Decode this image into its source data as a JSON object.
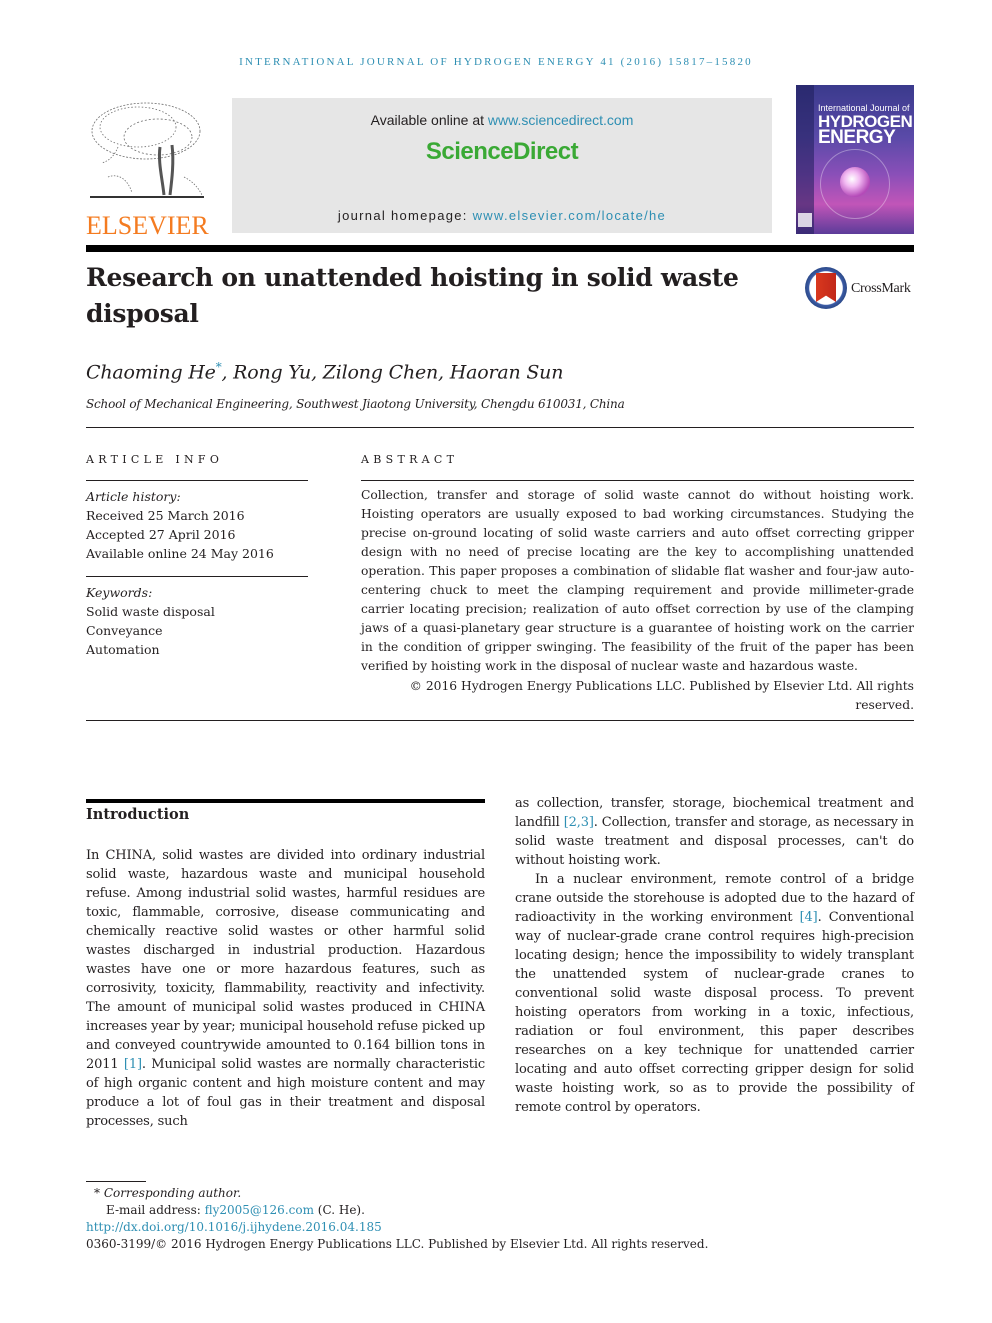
{
  "running_head": "INTERNATIONAL JOURNAL OF HYDROGEN ENERGY 41 (2016) 15817–15820",
  "masthead": {
    "publisher_logo_text": "ELSEVIER",
    "available_online_prefix": "Available online at ",
    "available_online_link": "www.sciencedirect.com",
    "platform_name": "ScienceDirect",
    "homepage_prefix": "journal homepage: ",
    "homepage_link": "www.elsevier.com/locate/he",
    "cover": {
      "line1": "International Journal of",
      "line2": "HYDROGEN",
      "line3": "ENERGY"
    }
  },
  "article": {
    "title": "Research on unattended hoisting in solid waste disposal",
    "crossmark_label": "CrossMark",
    "authors": [
      {
        "name": "Chaoming He",
        "corresponding": true,
        "mark": "*"
      },
      {
        "name": "Rong Yu"
      },
      {
        "name": "Zilong Chen"
      },
      {
        "name": "Haoran Sun"
      }
    ],
    "authors_rest": ", Rong Yu, Zilong Chen, Haoran Sun",
    "first_author": "Chaoming He",
    "corresponding_mark": "*",
    "affiliation": "School of Mechanical Engineering, Southwest Jiaotong University, Chengdu 610031, China"
  },
  "article_info": {
    "heading": "ARTICLE INFO",
    "history_label": "Article history:",
    "history": [
      "Received 25 March 2016",
      "Accepted 27 April 2016",
      "Available online 24 May 2016"
    ],
    "keywords_label": "Keywords:",
    "keywords": [
      "Solid waste disposal",
      "Conveyance",
      "Automation"
    ]
  },
  "abstract": {
    "heading": "ABSTRACT",
    "text": "Collection, transfer and storage of solid waste cannot do without hoisting work. Hoisting operators are usually exposed to bad working circumstances. Studying the precise on-ground locating of solid waste carriers and auto offset correcting gripper design with no need of precise locating are the key to accomplishing unattended operation. This paper proposes a combination of slidable flat washer and four-jaw auto-centering chuck to meet the clamping requirement and provide millimeter-grade carrier locating precision; realization of auto offset correction by use of the clamping jaws of a quasi-planetary gear structure is a guarantee of hoisting work on the carrier in the condition of gripper swinging. The feasibility of the fruit of the paper has been verified by hoisting work in the disposal of nuclear waste and hazardous waste.",
    "copyright": "© 2016 Hydrogen Energy Publications LLC. Published by Elsevier Ltd. All rights reserved."
  },
  "introduction": {
    "heading": "Introduction",
    "p1_a": "In CHINA, solid wastes are divided into ordinary industrial solid waste, hazardous waste and municipal household refuse. Among industrial solid wastes, harmful residues are toxic, flammable, corrosive, disease communicating and chemically reactive solid wastes or other harmful solid wastes discharged in industrial production. Hazardous wastes have one or more hazardous features, such as corrosivity, toxicity, flammability, reactivity and infectivity. The amount of municipal solid wastes produced in CHINA increases year by year; municipal household refuse picked up and conveyed countrywide amounted to 0.164 billion tons in 2011 ",
    "cite1": "[1]",
    "p1_b": ". Municipal solid wastes are normally characteristic of high organic content and high moisture content and may produce a lot of foul gas in their treatment and disposal processes, such as collection, transfer, storage, biochemical treatment and landfill ",
    "cite2": "[2,3]",
    "p1_c": ". Collection, transfer and storage, as necessary in solid waste treatment and disposal processes, can't do without hoisting work.",
    "p2_a": "In a nuclear environment, remote control of a bridge crane outside the storehouse is adopted due to the hazard of radioactivity in the working environment ",
    "cite3": "[4]",
    "p2_b": ". Conventional way of nuclear-grade crane control requires high-precision locating design; hence the impossibility to widely transplant the unattended system of nuclear-grade cranes to conventional solid waste disposal process. To prevent hoisting operators from working in a toxic, infectious, radiation or foul environment, this paper describes researches on a key technique for unattended carrier locating and auto offset correcting gripper design for solid waste hoisting work, so as to provide the possibility of remote control by operators.",
    "left_col_text_1": "In CHINA, solid wastes are divided into ordinary industrial solid waste, hazardous waste and municipal household refuse. Among industrial solid wastes, harmful residues are toxic, flammable, corrosive, disease communicating and chemically reactive solid wastes or other harmful solid wastes discharged in industrial production. Hazardous wastes have one or more hazardous features, such as corrosivity, toxicity, flammability, reactivity and infectivity. The amount of municipal solid wastes produced in CHINA increases year by year; municipal household refuse picked up and conveyed countrywide amounted to 0.164 billion tons in 2011 ",
    "left_col_text_2": ". Municipal solid wastes are normally characteristic of high organic content and high moisture content and may produce a lot of foul gas in their treatment and disposal processes, such",
    "right_col_text_1": "as collection, transfer, storage, biochemical treatment and landfill ",
    "right_col_text_2": ". Collection, transfer and storage, as necessary in solid waste treatment and disposal processes, can't do without hoisting work."
  },
  "footnotes": {
    "corresponding_mark": "*",
    "corresponding_label": "Corresponding author.",
    "email_label": "E-mail address: ",
    "email": "fly2005@126.com",
    "email_suffix": " (C. He).",
    "doi": "http://dx.doi.org/10.1016/j.ijhydene.2016.04.185",
    "issn_copyright": "0360-3199/© 2016 Hydrogen Energy Publications LLC. Published by Elsevier Ltd. All rights reserved."
  },
  "colors": {
    "link": "#2e8fb3",
    "elsevier_orange": "#f47b20",
    "sciencedirect_green": "#3aa935",
    "text": "#231f20"
  }
}
